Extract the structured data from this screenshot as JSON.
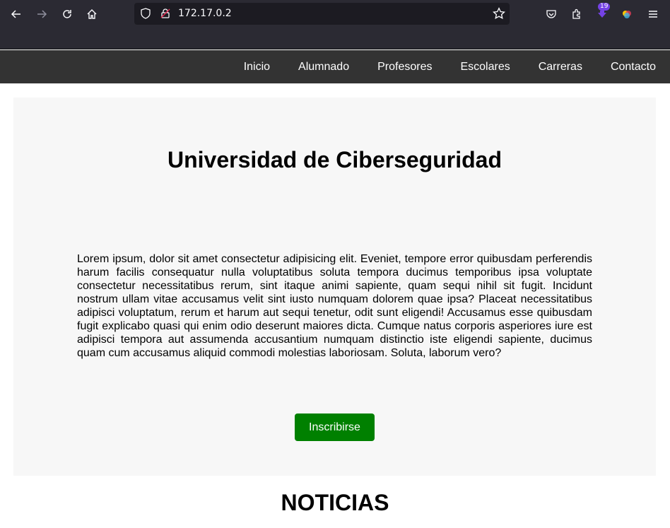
{
  "browser": {
    "url": "172.17.0.2",
    "extension_badge": "19"
  },
  "nav": {
    "items": [
      "Inicio",
      "Alumnado",
      "Profesores",
      "Escolares",
      "Carreras",
      "Contacto"
    ]
  },
  "hero": {
    "title": "Universidad de Ciberseguridad",
    "text": "Lorem ipsum, dolor sit amet consectetur adipisicing elit. Eveniet, tempore error quibusdam perferendis harum facilis consequatur nulla voluptatibus soluta tempora ducimus temporibus ipsa voluptate consectetur necessitatibus rerum, sint itaque animi sapiente, quam sequi nihil sit fugit. Incidunt nostrum ullam vitae accusamus velit sint iusto numquam dolorem quae ipsa? Placeat necessitatibus adipisci voluptatum, rerum et harum aut sequi tenetur, odit sunt eligendi! Accusamus esse quibusdam fugit explicabo quasi qui enim odio deserunt maiores dicta. Cumque natus corporis asperiores iure est adipisci tempora aut assumenda accusantium numquam distinctio iste eligendi sapiente, ducimus quam cum accusamus aliquid commodi molestias laboriosam. Soluta, laborum vero?",
    "button_label": "Inscribirse"
  },
  "news": {
    "title": "NOTICIAS"
  },
  "colors": {
    "nav_bg": "#333333",
    "hero_bg": "#f7f7f7",
    "button_bg": "#008000",
    "browser_bg": "#2b2a33"
  }
}
